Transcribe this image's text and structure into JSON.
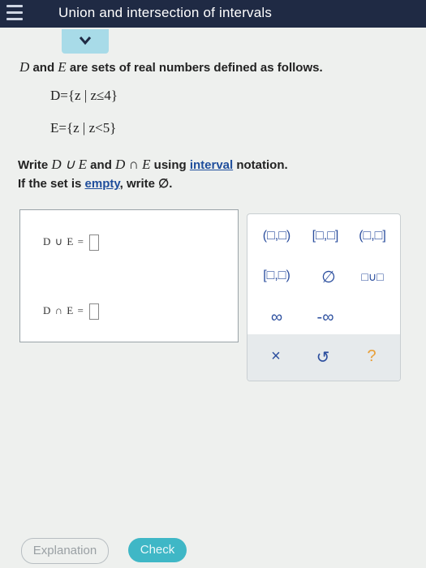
{
  "header": {
    "title": "Union and intersection of intervals"
  },
  "problem": {
    "intro_set1": "D",
    "intro_and": " and ",
    "intro_set2": "E",
    "intro_rest": " are sets of real numbers defined as follows.",
    "set_d": "D={z | z≤4}",
    "set_e": "E={z | z<5}",
    "instr1_a": "Write ",
    "instr1_expr1": "D ∪ E",
    "instr1_b": " and ",
    "instr1_expr2": "D ∩ E",
    "instr1_c": " using ",
    "instr1_link": "interval",
    "instr1_d": " notation.",
    "instr2_a": "If the set is ",
    "instr2_link": "empty",
    "instr2_b": ", write ∅."
  },
  "answers": {
    "union_label": "D ∪ E =",
    "intersection_label": "D ∩ E ="
  },
  "keypad": {
    "open_open": "(□,□)",
    "closed_closed": "[□,□]",
    "open_closed": "(□,□]",
    "closed_open": "[□,□)",
    "empty_set": "∅",
    "union": "□∪□",
    "infinity": "∞",
    "neg_infinity": "-∞",
    "clear": "×",
    "undo": "↺",
    "help": "?"
  },
  "footer": {
    "explanation_label": "Explanation",
    "check_label": "Check"
  },
  "colors": {
    "topbar": "#1f2a44",
    "accent": "#3fb7c6",
    "key_text": "#2b4e9e"
  }
}
